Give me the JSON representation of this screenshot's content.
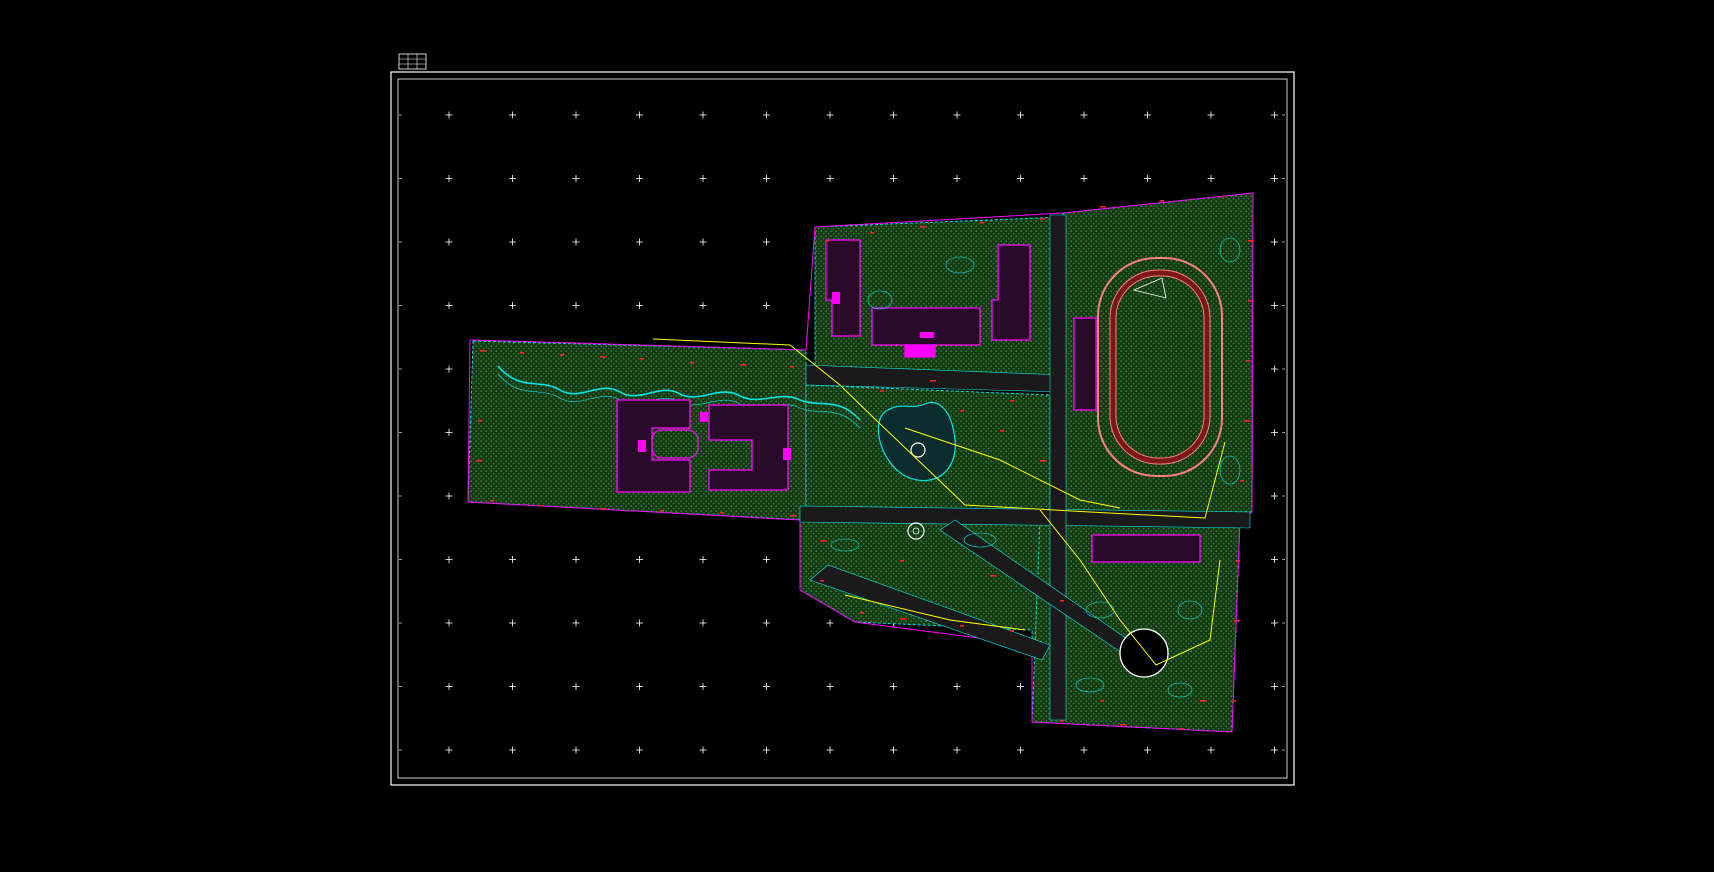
{
  "sheet": {
    "title": "",
    "footer_left": "",
    "footer_center": "",
    "footer_right": ""
  },
  "buildings": [
    {
      "id": "b1",
      "label": ""
    },
    {
      "id": "b2",
      "label": ""
    },
    {
      "id": "b3",
      "label": ""
    },
    {
      "id": "b4",
      "label": ""
    },
    {
      "id": "b5",
      "label": ""
    },
    {
      "id": "b6",
      "label": ""
    },
    {
      "id": "b7",
      "label": ""
    },
    {
      "id": "b8",
      "label": ""
    },
    {
      "id": "b9",
      "label": ""
    },
    {
      "id": "b10",
      "label": ""
    }
  ],
  "colors": {
    "background": "#000000",
    "frame": "#ffffff",
    "grid_cross": "#ffffff",
    "green_fill": "#1f4d1f",
    "green_dots": "#3fa63f",
    "building": "#ff00ff",
    "water": "#00e5e5",
    "path": "#ffff00",
    "track": "#ff7f7f",
    "accent_red": "#ff2020",
    "road": "#1a1a1a"
  },
  "icons": {
    "title_block": "title-block-icon",
    "grid": "crosshair-icon"
  }
}
